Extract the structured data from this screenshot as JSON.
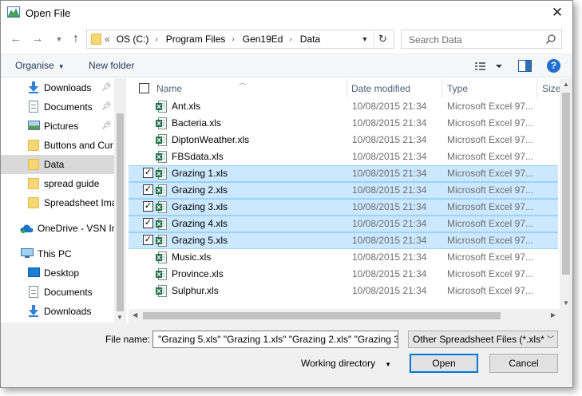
{
  "window": {
    "title": "Open File"
  },
  "address": {
    "overflow": "«",
    "crumbs": [
      "OS (C:)",
      "Program Files",
      "Gen19Ed",
      "Data"
    ]
  },
  "search": {
    "placeholder": "Search Data"
  },
  "toolbar": {
    "organise": "Organise",
    "new_folder": "New folder",
    "help": "?"
  },
  "navpane": {
    "items": [
      {
        "label": "Downloads",
        "icon": "download-arrow-icon",
        "pinned": true
      },
      {
        "label": "Documents",
        "icon": "document-icon",
        "pinned": true
      },
      {
        "label": "Pictures",
        "icon": "pictures-icon",
        "pinned": true
      },
      {
        "label": "Buttons and Cur",
        "icon": "folder-icon",
        "pinned": false
      },
      {
        "label": "Data",
        "icon": "folder-icon",
        "pinned": false,
        "selected": true
      },
      {
        "label": "spread guide",
        "icon": "folder-icon",
        "pinned": false
      },
      {
        "label": "Spreadsheet Ima",
        "icon": "folder-icon",
        "pinned": false
      },
      {
        "label": "OneDrive - VSN In",
        "icon": "onedrive-cloud-icon",
        "pinned": false
      },
      {
        "label": "This PC",
        "icon": "computer-icon",
        "pinned": false
      },
      {
        "label": "Desktop",
        "icon": "desktop-icon",
        "pinned": false
      },
      {
        "label": "Documents",
        "icon": "document-icon",
        "pinned": false
      },
      {
        "label": "Downloads",
        "icon": "download-arrow-icon",
        "pinned": false
      }
    ]
  },
  "filelist": {
    "columns": {
      "name": "Name",
      "date": "Date modified",
      "type": "Type",
      "size": "Size"
    },
    "files": [
      {
        "name": "Ant.xls",
        "date": "10/08/2015 21:34",
        "type": "Microsoft Excel 97...",
        "selected": false
      },
      {
        "name": "Bacteria.xls",
        "date": "10/08/2015 21:34",
        "type": "Microsoft Excel 97...",
        "selected": false
      },
      {
        "name": "DiptonWeather.xls",
        "date": "10/08/2015 21:34",
        "type": "Microsoft Excel 97...",
        "selected": false
      },
      {
        "name": "FBSdata.xls",
        "date": "10/08/2015 21:34",
        "type": "Microsoft Excel 97...",
        "selected": false
      },
      {
        "name": "Grazing 1.xls",
        "date": "10/08/2015 21:34",
        "type": "Microsoft Excel 97...",
        "selected": true
      },
      {
        "name": "Grazing 2.xls",
        "date": "10/08/2015 21:34",
        "type": "Microsoft Excel 97...",
        "selected": true
      },
      {
        "name": "Grazing 3.xls",
        "date": "10/08/2015 21:34",
        "type": "Microsoft Excel 97...",
        "selected": true
      },
      {
        "name": "Grazing 4.xls",
        "date": "10/08/2015 21:34",
        "type": "Microsoft Excel 97...",
        "selected": true
      },
      {
        "name": "Grazing 5.xls",
        "date": "10/08/2015 21:34",
        "type": "Microsoft Excel 97...",
        "selected": true
      },
      {
        "name": "Music.xls",
        "date": "10/08/2015 21:34",
        "type": "Microsoft Excel 97...",
        "selected": false
      },
      {
        "name": "Province.xls",
        "date": "10/08/2015 21:34",
        "type": "Microsoft Excel 97...",
        "selected": false
      },
      {
        "name": "Sulphur.xls",
        "date": "10/08/2015 21:34",
        "type": "Microsoft Excel 97...",
        "selected": false
      }
    ]
  },
  "bottom": {
    "file_name_label": "File name:",
    "file_name_value": "\"Grazing 5.xls\" \"Grazing 1.xls\" \"Grazing 2.xls\" \"Grazing 3",
    "filter_value": "Other Spreadsheet Files (*.xls*,*",
    "working_directory": "Working directory",
    "open": "Open",
    "cancel": "Cancel"
  },
  "colors": {
    "selection_bg": "#cce8ff",
    "selection_border": "#99d1ff",
    "accent": "#0078d7",
    "excel_green": "#1e7145"
  }
}
